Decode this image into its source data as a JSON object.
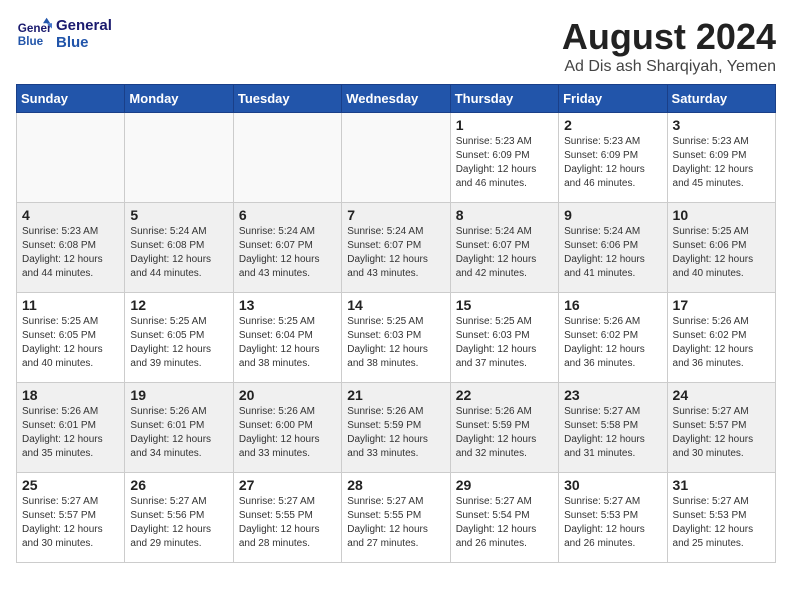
{
  "logo": {
    "line1": "General",
    "line2": "Blue"
  },
  "title": "August 2024",
  "location": "Ad Dis ash Sharqiyah, Yemen",
  "days_of_week": [
    "Sunday",
    "Monday",
    "Tuesday",
    "Wednesday",
    "Thursday",
    "Friday",
    "Saturday"
  ],
  "weeks": [
    [
      {
        "day": "",
        "info": ""
      },
      {
        "day": "",
        "info": ""
      },
      {
        "day": "",
        "info": ""
      },
      {
        "day": "",
        "info": ""
      },
      {
        "day": "1",
        "info": "Sunrise: 5:23 AM\nSunset: 6:09 PM\nDaylight: 12 hours\nand 46 minutes."
      },
      {
        "day": "2",
        "info": "Sunrise: 5:23 AM\nSunset: 6:09 PM\nDaylight: 12 hours\nand 46 minutes."
      },
      {
        "day": "3",
        "info": "Sunrise: 5:23 AM\nSunset: 6:09 PM\nDaylight: 12 hours\nand 45 minutes."
      }
    ],
    [
      {
        "day": "4",
        "info": "Sunrise: 5:23 AM\nSunset: 6:08 PM\nDaylight: 12 hours\nand 44 minutes."
      },
      {
        "day": "5",
        "info": "Sunrise: 5:24 AM\nSunset: 6:08 PM\nDaylight: 12 hours\nand 44 minutes."
      },
      {
        "day": "6",
        "info": "Sunrise: 5:24 AM\nSunset: 6:07 PM\nDaylight: 12 hours\nand 43 minutes."
      },
      {
        "day": "7",
        "info": "Sunrise: 5:24 AM\nSunset: 6:07 PM\nDaylight: 12 hours\nand 43 minutes."
      },
      {
        "day": "8",
        "info": "Sunrise: 5:24 AM\nSunset: 6:07 PM\nDaylight: 12 hours\nand 42 minutes."
      },
      {
        "day": "9",
        "info": "Sunrise: 5:24 AM\nSunset: 6:06 PM\nDaylight: 12 hours\nand 41 minutes."
      },
      {
        "day": "10",
        "info": "Sunrise: 5:25 AM\nSunset: 6:06 PM\nDaylight: 12 hours\nand 40 minutes."
      }
    ],
    [
      {
        "day": "11",
        "info": "Sunrise: 5:25 AM\nSunset: 6:05 PM\nDaylight: 12 hours\nand 40 minutes."
      },
      {
        "day": "12",
        "info": "Sunrise: 5:25 AM\nSunset: 6:05 PM\nDaylight: 12 hours\nand 39 minutes."
      },
      {
        "day": "13",
        "info": "Sunrise: 5:25 AM\nSunset: 6:04 PM\nDaylight: 12 hours\nand 38 minutes."
      },
      {
        "day": "14",
        "info": "Sunrise: 5:25 AM\nSunset: 6:03 PM\nDaylight: 12 hours\nand 38 minutes."
      },
      {
        "day": "15",
        "info": "Sunrise: 5:25 AM\nSunset: 6:03 PM\nDaylight: 12 hours\nand 37 minutes."
      },
      {
        "day": "16",
        "info": "Sunrise: 5:26 AM\nSunset: 6:02 PM\nDaylight: 12 hours\nand 36 minutes."
      },
      {
        "day": "17",
        "info": "Sunrise: 5:26 AM\nSunset: 6:02 PM\nDaylight: 12 hours\nand 36 minutes."
      }
    ],
    [
      {
        "day": "18",
        "info": "Sunrise: 5:26 AM\nSunset: 6:01 PM\nDaylight: 12 hours\nand 35 minutes."
      },
      {
        "day": "19",
        "info": "Sunrise: 5:26 AM\nSunset: 6:01 PM\nDaylight: 12 hours\nand 34 minutes."
      },
      {
        "day": "20",
        "info": "Sunrise: 5:26 AM\nSunset: 6:00 PM\nDaylight: 12 hours\nand 33 minutes."
      },
      {
        "day": "21",
        "info": "Sunrise: 5:26 AM\nSunset: 5:59 PM\nDaylight: 12 hours\nand 33 minutes."
      },
      {
        "day": "22",
        "info": "Sunrise: 5:26 AM\nSunset: 5:59 PM\nDaylight: 12 hours\nand 32 minutes."
      },
      {
        "day": "23",
        "info": "Sunrise: 5:27 AM\nSunset: 5:58 PM\nDaylight: 12 hours\nand 31 minutes."
      },
      {
        "day": "24",
        "info": "Sunrise: 5:27 AM\nSunset: 5:57 PM\nDaylight: 12 hours\nand 30 minutes."
      }
    ],
    [
      {
        "day": "25",
        "info": "Sunrise: 5:27 AM\nSunset: 5:57 PM\nDaylight: 12 hours\nand 30 minutes."
      },
      {
        "day": "26",
        "info": "Sunrise: 5:27 AM\nSunset: 5:56 PM\nDaylight: 12 hours\nand 29 minutes."
      },
      {
        "day": "27",
        "info": "Sunrise: 5:27 AM\nSunset: 5:55 PM\nDaylight: 12 hours\nand 28 minutes."
      },
      {
        "day": "28",
        "info": "Sunrise: 5:27 AM\nSunset: 5:55 PM\nDaylight: 12 hours\nand 27 minutes."
      },
      {
        "day": "29",
        "info": "Sunrise: 5:27 AM\nSunset: 5:54 PM\nDaylight: 12 hours\nand 26 minutes."
      },
      {
        "day": "30",
        "info": "Sunrise: 5:27 AM\nSunset: 5:53 PM\nDaylight: 12 hours\nand 26 minutes."
      },
      {
        "day": "31",
        "info": "Sunrise: 5:27 AM\nSunset: 5:53 PM\nDaylight: 12 hours\nand 25 minutes."
      }
    ]
  ]
}
